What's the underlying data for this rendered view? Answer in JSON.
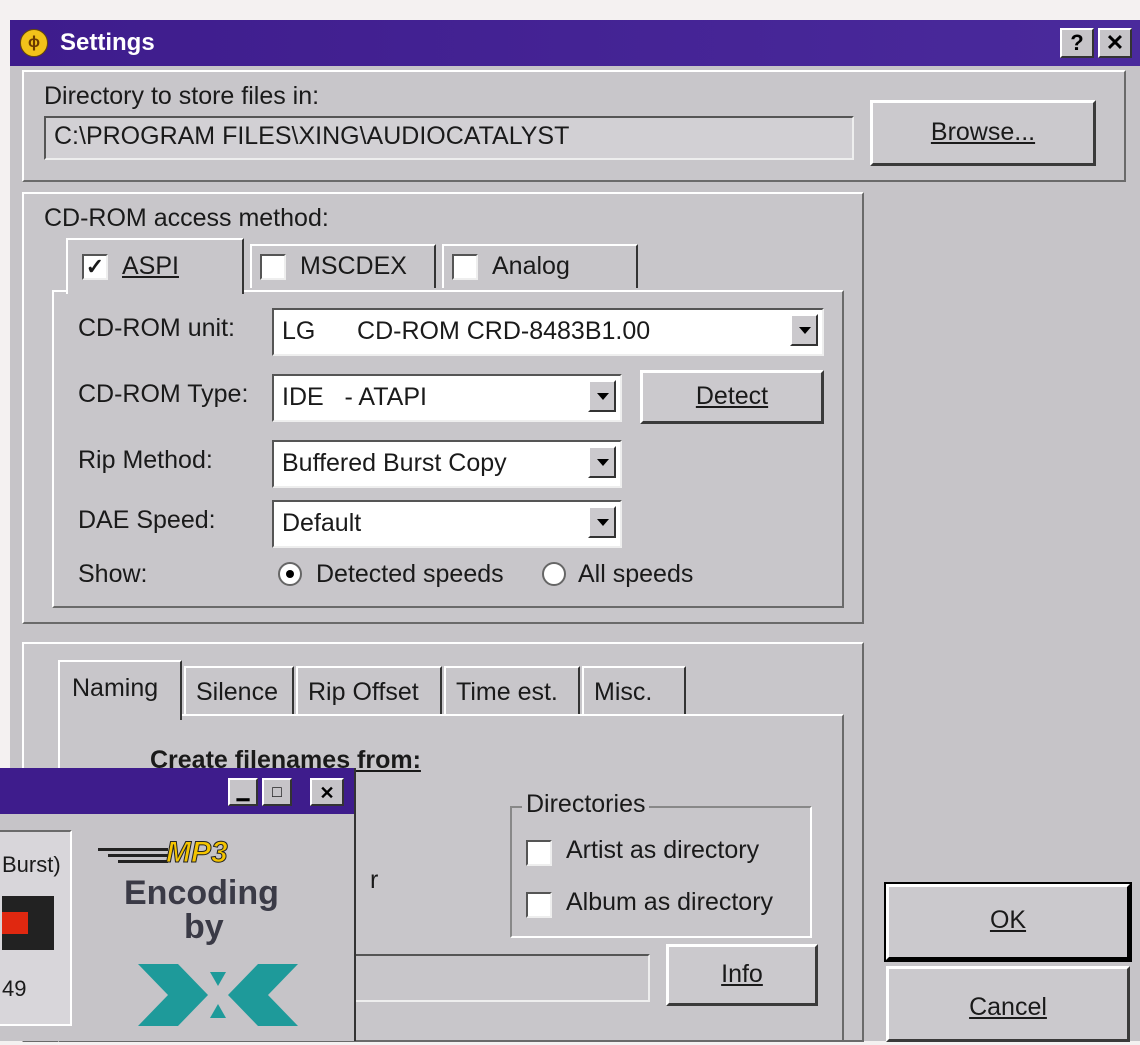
{
  "window": {
    "title": "Settings",
    "help_button": "?",
    "close_button": "✕"
  },
  "directory": {
    "label": "Directory to store files in:",
    "value": "C:\\PROGRAM FILES\\XING\\AUDIOCATALYST",
    "browse_label": "Browse..."
  },
  "cdrom": {
    "group_label": "CD-ROM access method:",
    "tabs": [
      {
        "label": "ASPI",
        "checked": true
      },
      {
        "label": "MSCDEX",
        "checked": false
      },
      {
        "label": "Analog",
        "checked": false
      }
    ],
    "unit_label": "CD-ROM unit:",
    "unit_value": "LG      CD-ROM CRD-8483B1.00",
    "type_label": "CD-ROM Type:",
    "type_value": "IDE   - ATAPI",
    "detect_label": "Detect",
    "rip_label": "Rip Method:",
    "rip_value": "Buffered Burst Copy",
    "dae_label": "DAE Speed:",
    "dae_value": "Default",
    "show_label": "Show:",
    "radio_detected": "Detected speeds",
    "radio_all": "All speeds"
  },
  "options": {
    "tabs": [
      "Naming",
      "Silence",
      "Rip Offset",
      "Time est.",
      "Misc."
    ],
    "create_label": "Create filenames from:",
    "directories_label": "Directories",
    "artist_dir": "Artist as directory",
    "album_dir": "Album as directory",
    "partial_text": "r",
    "info_label": "Info"
  },
  "buttons": {
    "ok": "OK",
    "cancel": "Cancel"
  },
  "overlay": {
    "burst_text": "Burst)",
    "number_text": "49",
    "logo_mp3": "MP3",
    "logo_encoding": "Encoding",
    "logo_by": "by"
  }
}
